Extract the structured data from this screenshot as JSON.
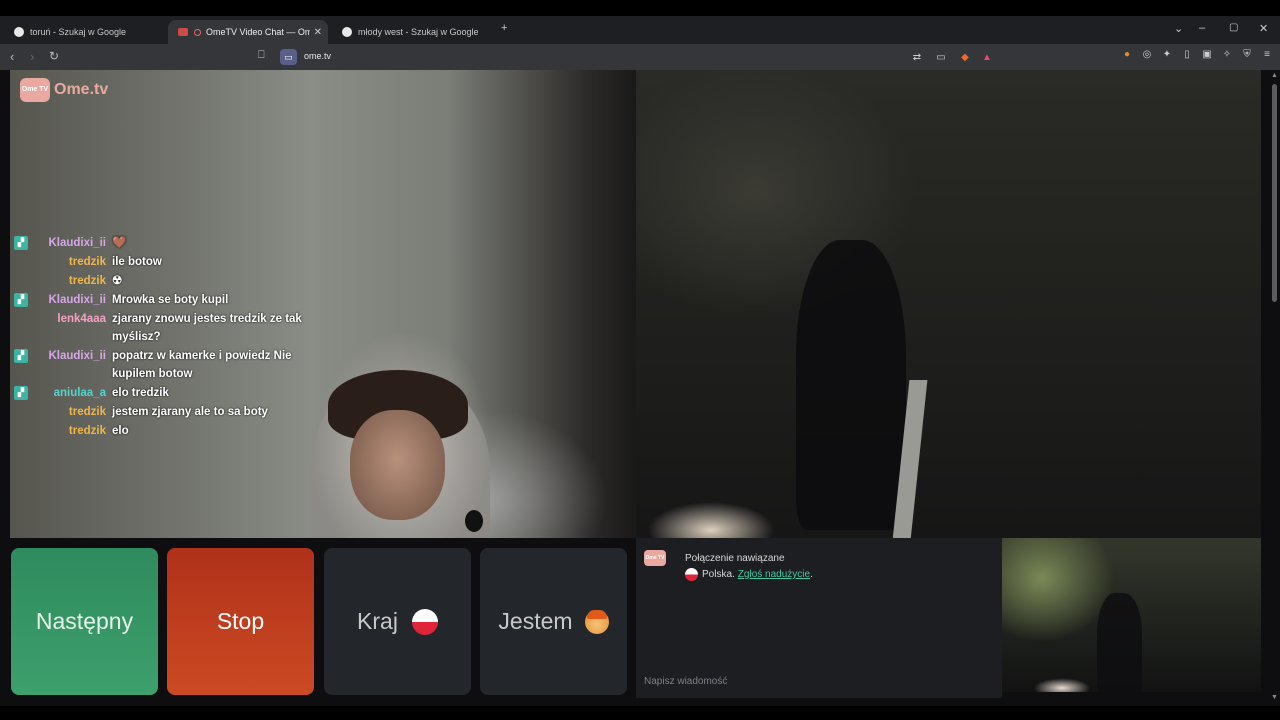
{
  "browser": {
    "tabs": [
      {
        "title": "toruń - Szukaj w Google",
        "active": false
      },
      {
        "title": "OmeTV Video Chat — Omegl",
        "active": true
      },
      {
        "title": "młody west - Szukaj w Google",
        "active": false
      }
    ],
    "new_tab": "+",
    "url": "ome.tv",
    "window_controls": {
      "dropdown": "⌄",
      "minimize": "–",
      "maximize": "▢",
      "close": "✕"
    }
  },
  "site": {
    "logo_badge": "Ome TV",
    "logo_text": "Ome.tv"
  },
  "overlay_chat": [
    {
      "user": "Klaudixi_ii",
      "text": "🤎",
      "user_color": "#d7a6e8",
      "icon": true
    },
    {
      "user": "tredzik",
      "text": "ile botow",
      "user_color": "#f0b64c",
      "icon": false
    },
    {
      "user": "tredzik",
      "text": "☢",
      "user_color": "#f0b64c",
      "icon": false
    },
    {
      "user": "Klaudixi_ii",
      "text": "Mrowka se boty kupil",
      "user_color": "#d7a6e8",
      "icon": true
    },
    {
      "user": "lenk4aaa",
      "text": "zjarany znowu jestes tredzik ze tak myślisz?",
      "user_color": "#f2a3c3",
      "icon": false
    },
    {
      "user": "Klaudixi_ii",
      "text": "popatrz w kamerke i powiedz Nie kupilem botow",
      "user_color": "#d7a6e8",
      "icon": true
    },
    {
      "user": "aniulaa_a",
      "text": "elo tredzik",
      "user_color": "#55d4cf",
      "icon": true
    },
    {
      "user": "tredzik",
      "text": "jestem zjarany ale to sa boty",
      "user_color": "#f0b64c",
      "icon": false
    },
    {
      "user": "tredzik",
      "text": "elo",
      "user_color": "#f0b64c",
      "icon": false
    }
  ],
  "controls": {
    "next": "Następny",
    "stop": "Stop",
    "country": "Kraj",
    "gender": "Jestem"
  },
  "chat_panel": {
    "status": "Połączenie nawiązane",
    "country": "Polska.",
    "report": "Zgłoś nadużycie",
    "report_suffix": ".",
    "input_placeholder": "Napisz wiadomość"
  },
  "colors": {
    "next": "#35946a",
    "stop": "#c03f1f",
    "accent": "#45c9a0"
  }
}
